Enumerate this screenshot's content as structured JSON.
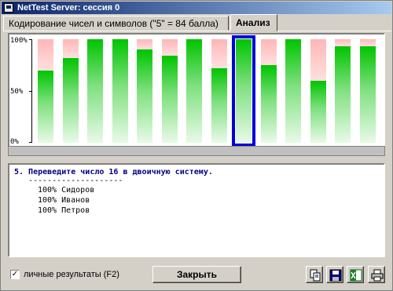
{
  "window": {
    "title": "NetTest Server: сессия 0"
  },
  "tabs": [
    {
      "label": "Кодирование чисел и символов (\"5\" = 84 балла)"
    },
    {
      "label": "Анализ"
    }
  ],
  "chart_data": {
    "type": "bar",
    "y_ticks": [
      "100%",
      "50%",
      "0%"
    ],
    "ylim": [
      0,
      100
    ],
    "values": [
      70,
      82,
      100,
      100,
      90,
      84,
      100,
      72,
      100,
      75,
      100,
      60,
      93,
      93
    ],
    "selected_index": 8,
    "colors": {
      "correct": "#00c400",
      "incorrect": "#ffb6b6",
      "selected": "#0000d8"
    }
  },
  "details": {
    "question": "5. Переведите число 16 в двоичную систему.",
    "separator": "--------------------",
    "results": [
      "100% Сидоров",
      "100% Иванов",
      "100% Петров"
    ]
  },
  "footer": {
    "checkbox_label": "личные результаты (F2)",
    "checkbox_checked": true,
    "close_label": "Закрыть",
    "icons": [
      "copy-icon",
      "save-icon",
      "excel-icon",
      "print-icon"
    ]
  }
}
